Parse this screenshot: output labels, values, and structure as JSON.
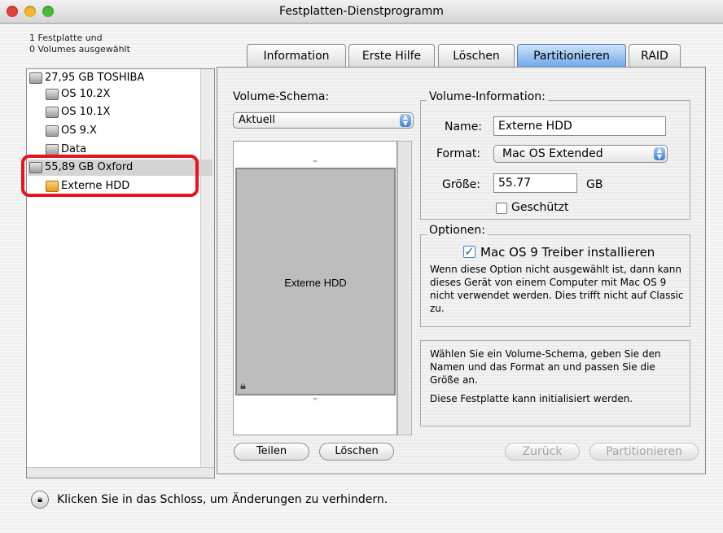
{
  "window": {
    "title": "Festplatten-Dienstprogramm"
  },
  "sidebar": {
    "selection_count_line1": "1 Festplatte und",
    "selection_count_line2": "0 Volumes ausgewählt",
    "items": [
      {
        "label": "27,95 GB TOSHIBA",
        "icon": "hard-disk-icon"
      },
      {
        "label": "OS 10.2X",
        "icon": "volume-icon"
      },
      {
        "label": "OS 10.1X",
        "icon": "volume-icon"
      },
      {
        "label": "OS 9.X",
        "icon": "volume-icon"
      },
      {
        "label": "Data",
        "icon": "volume-icon"
      },
      {
        "label": "55,89 GB Oxford",
        "icon": "hard-disk-icon"
      },
      {
        "label": "Externe HDD",
        "icon": "external-volume-icon"
      }
    ]
  },
  "tabs": [
    {
      "label": "Information"
    },
    {
      "label": "Erste Hilfe"
    },
    {
      "label": "Löschen"
    },
    {
      "label": "Partitionieren",
      "active": true
    },
    {
      "label": "RAID"
    }
  ],
  "partition": {
    "scheme_label": "Volume-Schema:",
    "scheme_value": "Aktuell",
    "volume_name": "Externe HDD",
    "split_button": "Teilen",
    "delete_button": "Löschen"
  },
  "volume_info": {
    "legend": "Volume-Information:",
    "name_label": "Name:",
    "name_value": "Externe HDD",
    "format_label": "Format:",
    "format_value": "Mac OS Extended",
    "size_label": "Größe:",
    "size_value": "55.77",
    "size_unit": "GB",
    "protected_label": "Geschützt",
    "protected_checked": false
  },
  "options": {
    "legend": "Optionen:",
    "driver_label": "Mac OS 9 Treiber installieren",
    "driver_checked": true,
    "text": "Wenn diese Option nicht ausgewählt ist, dann kann dieses Gerät von einem Computer mit Mac OS 9 nicht verwendet werden. Dies trifft nicht auf Classic zu."
  },
  "help": {
    "text1": "Wählen Sie ein Volume-Schema, geben Sie den Namen und das Format an und passen Sie die Größe an.",
    "text2": "Diese Festplatte kann initialisiert werden."
  },
  "actions": {
    "back_button": "Zurück",
    "partition_button": "Partitionieren"
  },
  "footer": {
    "lock_text": "Klicken Sie in das Schloss, um Änderungen zu verhindern."
  },
  "colors": {
    "highlight": "#e8131b",
    "active_tab": "#6fa8ea",
    "close": "#e0443e",
    "minimize": "#f5b731",
    "zoom": "#4cba3a"
  }
}
